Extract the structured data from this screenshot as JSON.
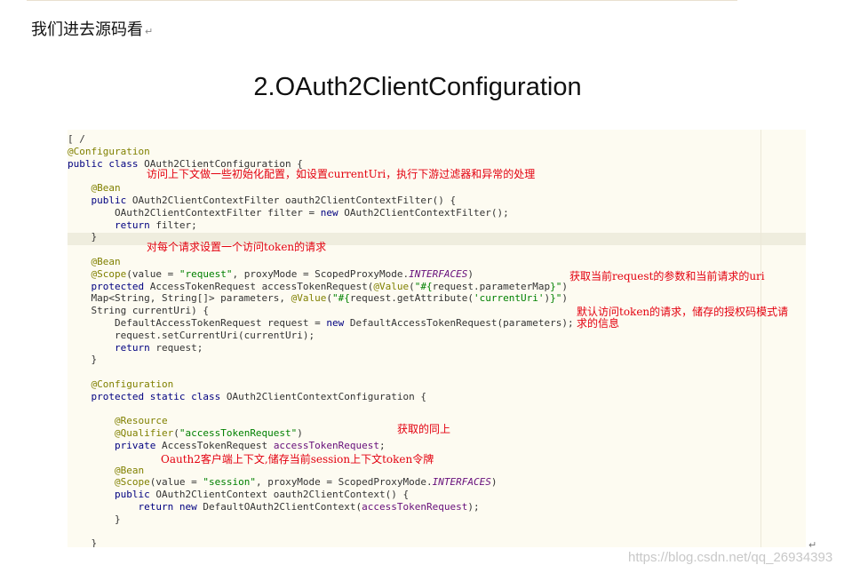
{
  "intro": {
    "text": "我们进去源码看",
    "mark": "↵"
  },
  "heading": "2.OAuth2ClientConfiguration",
  "code": [
    {
      "parts": [
        [
          "",
          "[ /"
        ]
      ]
    },
    {
      "parts": [
        [
          "annot",
          "@Configuration"
        ]
      ]
    },
    {
      "parts": [
        [
          "kw",
          "public class "
        ],
        [
          "",
          "OAuth2ClientConfiguration {"
        ]
      ]
    },
    {
      "parts": [
        [
          "",
          ""
        ]
      ]
    },
    {
      "parts": [
        [
          "",
          "    "
        ],
        [
          "annot",
          "@Bean"
        ]
      ]
    },
    {
      "parts": [
        [
          "",
          "    "
        ],
        [
          "kw",
          "public "
        ],
        [
          "",
          "OAuth2ClientContextFilter oauth2ClientContextFilter() {"
        ]
      ]
    },
    {
      "parts": [
        [
          "",
          "        OAuth2ClientContextFilter filter = "
        ],
        [
          "kw",
          "new "
        ],
        [
          "",
          "OAuth2ClientContextFilter();"
        ]
      ]
    },
    {
      "parts": [
        [
          "",
          "        "
        ],
        [
          "kw",
          "return "
        ],
        [
          "",
          "filter;"
        ]
      ]
    },
    {
      "parts": [
        [
          "",
          "    }"
        ]
      ]
    },
    {
      "parts": [
        [
          "",
          ""
        ]
      ]
    },
    {
      "parts": [
        [
          "",
          "    "
        ],
        [
          "annot",
          "@Bean"
        ]
      ]
    },
    {
      "parts": [
        [
          "",
          "    "
        ],
        [
          "annot",
          "@Scope"
        ],
        [
          "",
          "(value = "
        ],
        [
          "str",
          "\"request\""
        ],
        [
          "",
          ", proxyMode = ScopedProxyMode."
        ],
        [
          "ital",
          "INTERFACES"
        ],
        [
          "",
          ")"
        ]
      ]
    },
    {
      "parts": [
        [
          "",
          "    "
        ],
        [
          "kw",
          "protected "
        ],
        [
          "",
          "AccessTokenRequest accessTokenRequest("
        ],
        [
          "annot",
          "@Value"
        ],
        [
          "",
          "("
        ],
        [
          "str",
          "\"#{"
        ],
        [
          "",
          "request.parameterMap"
        ],
        [
          "str",
          "}\""
        ],
        [
          "",
          ")"
        ]
      ]
    },
    {
      "parts": [
        [
          "",
          "    Map<String, String[]> parameters, "
        ],
        [
          "annot",
          "@Value"
        ],
        [
          "",
          "("
        ],
        [
          "str",
          "\"#{"
        ],
        [
          "",
          "request.getAttribute("
        ],
        [
          "str",
          "'currentUri'"
        ],
        [
          "",
          ")"
        ],
        [
          "str",
          "}\""
        ],
        [
          "",
          ")"
        ]
      ]
    },
    {
      "parts": [
        [
          "",
          "    String currentUri) {"
        ]
      ]
    },
    {
      "parts": [
        [
          "",
          "        DefaultAccessTokenRequest request = "
        ],
        [
          "kw",
          "new "
        ],
        [
          "",
          "DefaultAccessTokenRequest(parameters);"
        ]
      ]
    },
    {
      "parts": [
        [
          "",
          "        request.setCurrentUri(currentUri);"
        ]
      ]
    },
    {
      "parts": [
        [
          "",
          "        "
        ],
        [
          "kw",
          "return "
        ],
        [
          "",
          "request;"
        ]
      ]
    },
    {
      "parts": [
        [
          "",
          "    }"
        ]
      ]
    },
    {
      "parts": [
        [
          "",
          ""
        ]
      ]
    },
    {
      "parts": [
        [
          "",
          "    "
        ],
        [
          "annot",
          "@Configuration"
        ]
      ]
    },
    {
      "parts": [
        [
          "",
          "    "
        ],
        [
          "kw",
          "protected static class "
        ],
        [
          "",
          "OAuth2ClientContextConfiguration {"
        ]
      ]
    },
    {
      "parts": [
        [
          "",
          ""
        ]
      ]
    },
    {
      "parts": [
        [
          "",
          "        "
        ],
        [
          "annot",
          "@Resource"
        ]
      ]
    },
    {
      "parts": [
        [
          "",
          "        "
        ],
        [
          "annot",
          "@Qualifier"
        ],
        [
          "",
          "("
        ],
        [
          "str",
          "\"accessTokenRequest\""
        ],
        [
          "",
          ")"
        ]
      ]
    },
    {
      "parts": [
        [
          "",
          "        "
        ],
        [
          "kw",
          "private "
        ],
        [
          "",
          "AccessTokenRequest "
        ],
        [
          "fld",
          "accessTokenRequest"
        ],
        [
          "",
          ";"
        ]
      ]
    },
    {
      "parts": [
        [
          "",
          ""
        ]
      ]
    },
    {
      "parts": [
        [
          "",
          "        "
        ],
        [
          "annot",
          "@Bean"
        ]
      ]
    },
    {
      "parts": [
        [
          "",
          "        "
        ],
        [
          "annot",
          "@Scope"
        ],
        [
          "",
          "(value = "
        ],
        [
          "str",
          "\"session\""
        ],
        [
          "",
          ", proxyMode = ScopedProxyMode."
        ],
        [
          "ital",
          "INTERFACES"
        ],
        [
          "",
          ")"
        ]
      ]
    },
    {
      "parts": [
        [
          "",
          "        "
        ],
        [
          "kw",
          "public "
        ],
        [
          "",
          "OAuth2ClientContext oauth2ClientContext() {"
        ]
      ]
    },
    {
      "parts": [
        [
          "",
          "            "
        ],
        [
          "kw",
          "return new "
        ],
        [
          "",
          "DefaultOAuth2ClientContext("
        ],
        [
          "fld",
          "accessTokenRequest"
        ],
        [
          "",
          ");"
        ]
      ]
    },
    {
      "parts": [
        [
          "",
          "        }"
        ]
      ]
    },
    {
      "parts": [
        [
          "",
          ""
        ]
      ]
    },
    {
      "parts": [
        [
          "",
          "    }"
        ]
      ]
    }
  ],
  "comments": {
    "c1": "访问上下文做一些初始化配置，如设置currentUri，执行下游过滤器和异常的处理",
    "c2": "对每个请求设置一个访问token的请求",
    "c3": "获取当前request的参数和当前请求的uri",
    "c4a": "默认访问token的请求，储存的授权码模式请",
    "c4b": "求的信息",
    "c5": "获取的同上",
    "c6": "Oauth2客户端上下文,储存当前session上下文token令牌"
  },
  "end_mark": "↵",
  "watermark": "https://blog.csdn.net/qq_26934393"
}
